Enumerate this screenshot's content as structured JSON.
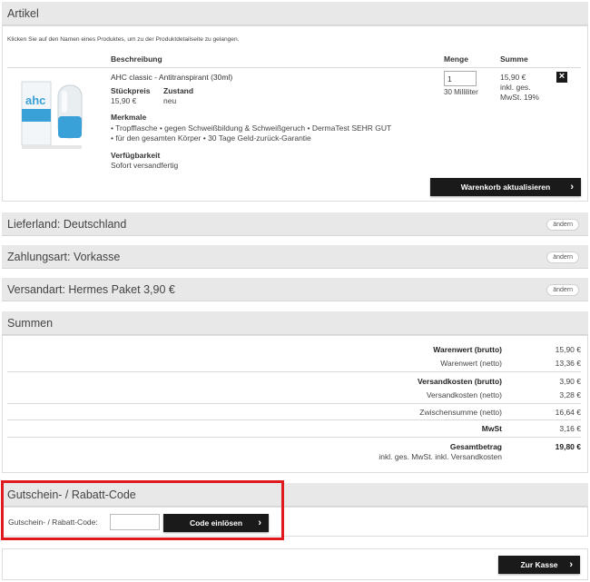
{
  "artikel": {
    "title": "Artikel",
    "hint": "Klicken Sie auf den Namen eines Produktes, um zu der Produktdetailseite zu gelangen.",
    "headers": {
      "beschreibung": "Beschreibung",
      "menge": "Menge",
      "summe": "Summe"
    },
    "product": {
      "name": "AHC classic - Antitranspirant (30ml)",
      "stueckpreis_label": "Stückpreis",
      "stueckpreis": "15,90 €",
      "zustand_label": "Zustand",
      "zustand": "neu",
      "merkmale_label": "Merkmale",
      "merkmale_line1": "• Tropfflasche • gegen Schweißbildung & Schweißgeruch • DermaTest SEHR GUT",
      "merkmale_line2": "• für den gesamten Körper • 30 Tage Geld-zurück-Garantie",
      "verfuegbarkeit_label": "Verfügbarkeit",
      "verfuegbarkeit": "Sofort versandfertig",
      "quantity": "1",
      "unit": "30 Milliliter",
      "sum": "15,90 €",
      "tax_note1": "inkl. ges.",
      "tax_note2": "MwSt. 19%",
      "remove_icon": "close-icon",
      "image_brand": "ahc"
    },
    "update_button": "Warenkorb aktualisieren"
  },
  "lieferland": {
    "title": "Lieferland: Deutschland",
    "change": "ändern"
  },
  "zahlungsart": {
    "title": "Zahlungsart: Vorkasse",
    "change": "ändern"
  },
  "versandart": {
    "title": "Versandart: Hermes Paket 3,90 €",
    "change": "ändern"
  },
  "summen": {
    "title": "Summen",
    "rows": [
      {
        "label": "Warenwert (brutto)",
        "value": "15,90 €"
      },
      {
        "label": "Warenwert (netto)",
        "value": "13,36 €"
      },
      {
        "label": "Versandkosten (brutto)",
        "value": "3,90 €"
      },
      {
        "label": "Versandkosten (netto)",
        "value": "3,28 €"
      },
      {
        "label": "Zwischensumme (netto)",
        "value": "16,64 €"
      },
      {
        "label": "MwSt",
        "value": "3,16 €"
      },
      {
        "label": "Gesamtbetrag",
        "value": "19,80 €"
      }
    ],
    "total_note": "inkl. ges. MwSt. inkl. Versandkosten"
  },
  "gutschein": {
    "title": "Gutschein- / Rabatt-Code",
    "field_label": "Gutschein- / Rabatt-Code:",
    "input_value": "",
    "button": "Code einlösen"
  },
  "checkout": {
    "button": "Zur Kasse"
  },
  "colors": {
    "highlight": "#e0191f",
    "button_bg": "#1a1a1a",
    "section_bg": "#e8e8e8",
    "brand_blue": "#3aa0d8"
  }
}
